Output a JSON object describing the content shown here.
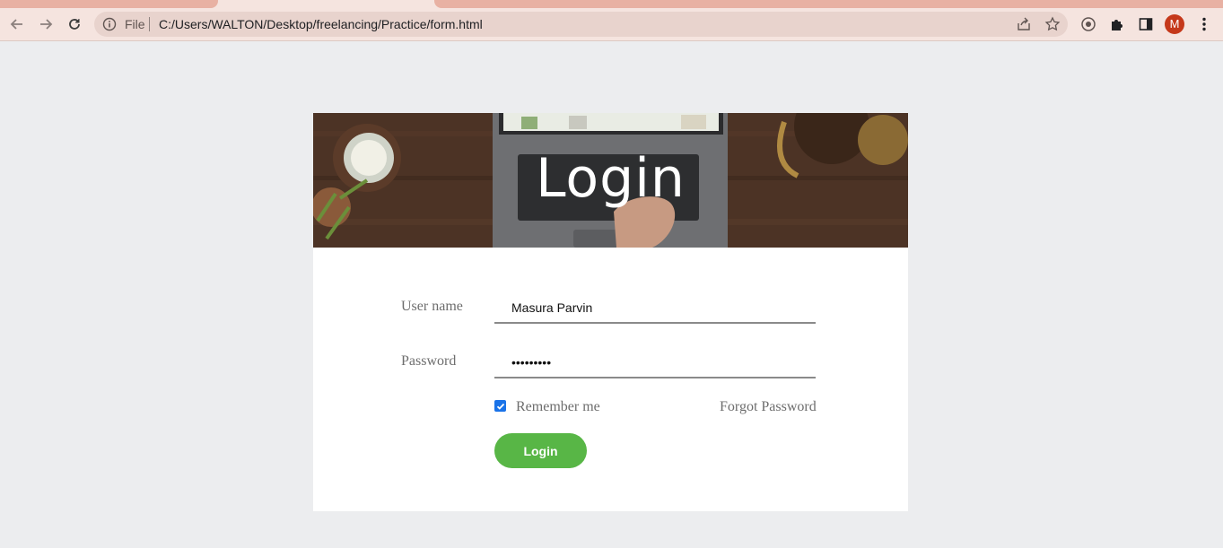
{
  "browser": {
    "omnibox": {
      "scheme_label": "File",
      "url": "C:/Users/WALTON/Desktop/freelancing/Practice/form.html"
    },
    "profile_initial": "M",
    "icons": [
      "back-icon",
      "forward-icon",
      "reload-icon",
      "info-icon",
      "share-icon",
      "star-icon",
      "extension-puzzle-icon",
      "side-panel-icon",
      "more-menu-icon"
    ]
  },
  "hero": {
    "title": "Login"
  },
  "form": {
    "username_label": "User name",
    "username_value": "Masura Parvin",
    "password_label": "Password",
    "password_value": "•••••••••",
    "remember_label": "Remember me",
    "remember_checked": true,
    "forgot_label": "Forgot Password",
    "submit_label": "Login"
  },
  "colors": {
    "page_bg": "#ecedef",
    "chrome_bg": "#f5e4df",
    "accent_button": "#58b646",
    "checkbox": "#1a73e8",
    "avatar": "#c5381a"
  }
}
